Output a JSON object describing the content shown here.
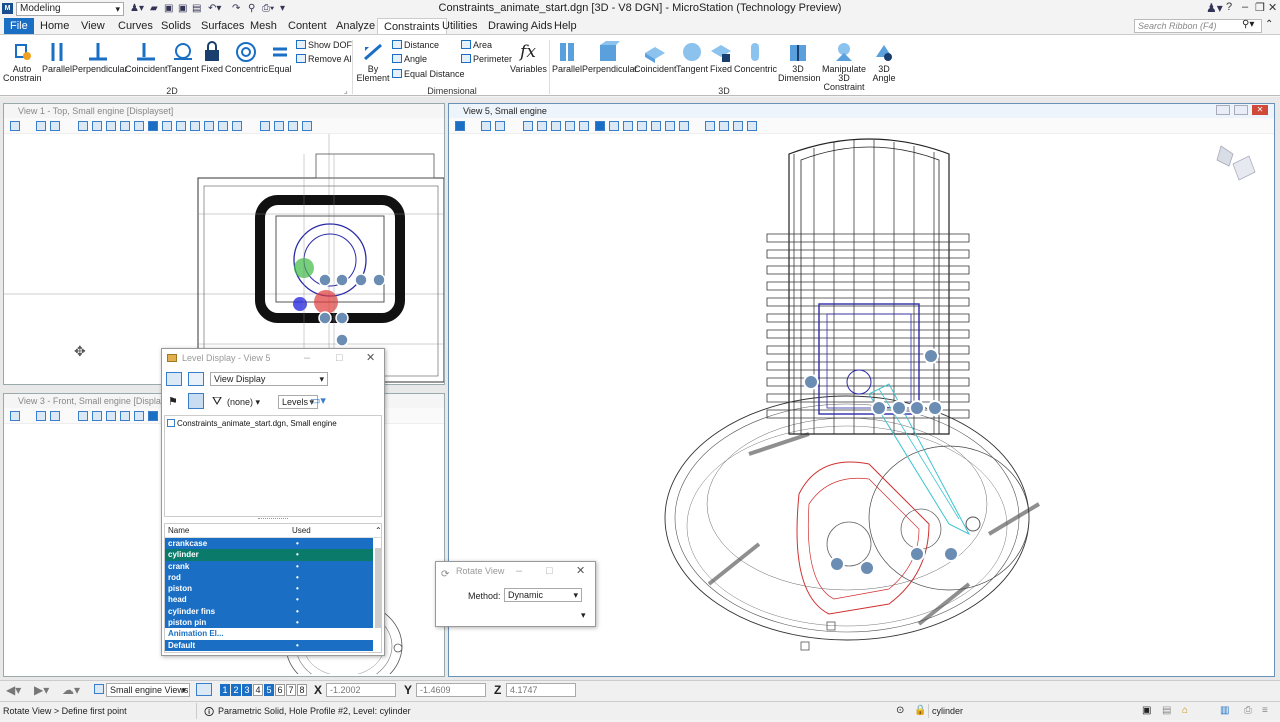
{
  "app": {
    "title": "Constraints_animate_start.dgn [3D - V8 DGN] - MicroStation (Technology Preview)",
    "workspace": "Modeling"
  },
  "menu": [
    "File",
    "Home",
    "View",
    "Curves",
    "Solids",
    "Surfaces",
    "Mesh",
    "Content",
    "Analyze",
    "Constraints",
    "Utilities",
    "Drawing Aids",
    "Help"
  ],
  "search_placeholder": "Search Ribbon (F4)",
  "ribbon": {
    "group_2d": {
      "label": "2D",
      "buttons": [
        "Auto Constrain",
        "Parallel",
        "Perpendicular",
        "Coincident",
        "Tangent",
        "Fixed",
        "Concentric",
        "Equal"
      ],
      "small": [
        "Show DOF",
        "Remove All"
      ]
    },
    "group_dim": {
      "label": "Dimensional",
      "by_element": "By Element",
      "small_col1": [
        "Distance",
        "Angle",
        "Equal Distance"
      ],
      "small_col2": [
        "Area",
        "Perimeter"
      ],
      "variables": "Variables"
    },
    "group_3d": {
      "label": "3D",
      "buttons": [
        "Parallel",
        "Perpendicular",
        "Coincident",
        "Tangent",
        "Fixed",
        "Concentric",
        "3D Dimension",
        "Manipulate 3D Constraint",
        "3D Angle"
      ]
    }
  },
  "views": {
    "v1_title": "View 1 - Top, Small engine [Displayset]",
    "v3_title": "View 3 - Front, Small engine [Displayset]",
    "v5_title": "View 5, Small engine"
  },
  "level_dialog": {
    "title": "Level Display - View 5",
    "mode": "View Display",
    "filter": "(none)",
    "levels_combo": "Levels",
    "file_item": "Constraints_animate_start.dgn, Small engine",
    "col_name": "Name",
    "col_used": "Used",
    "levels": [
      {
        "name": "crankcase",
        "used": "•"
      },
      {
        "name": "cylinder",
        "used": "•"
      },
      {
        "name": "crank",
        "used": "•"
      },
      {
        "name": "rod",
        "used": "•"
      },
      {
        "name": "piston",
        "used": "•"
      },
      {
        "name": "head",
        "used": "•"
      },
      {
        "name": "cylinder fins",
        "used": "•"
      },
      {
        "name": "piston pin",
        "used": "•"
      },
      {
        "name": "Animation El...",
        "used": ""
      },
      {
        "name": "Default",
        "used": "•"
      }
    ]
  },
  "rotate_dialog": {
    "title": "Rotate View",
    "method_label": "Method:",
    "method": "Dynamic"
  },
  "viewbar": {
    "views_combo": "Small engine Views",
    "view_numbers": [
      "1",
      "2",
      "3",
      "4",
      "5",
      "6",
      "7",
      "8"
    ],
    "x_label": "X",
    "x_val": "-1.2002",
    "y_label": "Y",
    "y_val": "-1.4609",
    "z_label": "Z",
    "z_val": "4.1747"
  },
  "status": {
    "prompt": "Rotate View > Define first point",
    "message": "Parametric Solid, Hole Profile #2, Level: cylinder",
    "active_level": "cylinder"
  },
  "colors": {
    "accent": "#1a6fc4",
    "selected_row": "#0a7a6a"
  }
}
